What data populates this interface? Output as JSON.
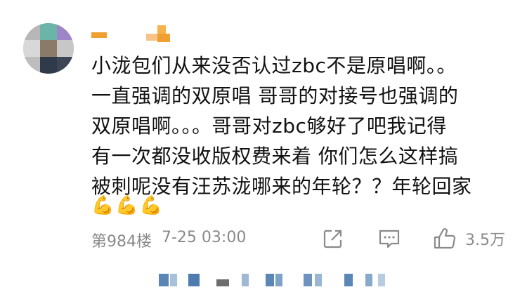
{
  "comment": {
    "lines": [
      "小泷包们从来没否认过zbc不是原唱啊。。",
      "一直强调的双原唱 哥哥的对接号也强调的",
      "双原唱啊。。。哥哥对zbc够好了吧我记得",
      "有一次都没收版权费来着 你们怎么这样搞",
      "被刺呢没有汪苏泷哪来的年轮？？年轮回家"
    ],
    "emojis": [
      "💪",
      "💪",
      "💪"
    ]
  },
  "meta": {
    "floor": "第984楼",
    "timestamp": "7-25 03:00"
  },
  "actions": {
    "share_icon": "share-icon",
    "comment_icon": "comment-icon",
    "like_icon": "thumbs-up-icon",
    "like_count": "3.5万"
  },
  "colors": {
    "text": "#111111",
    "meta": "#8a8a8a",
    "icon": "#8a8a8a",
    "blur_blue": "#5b87b6",
    "username_orange": "#f0a030"
  }
}
